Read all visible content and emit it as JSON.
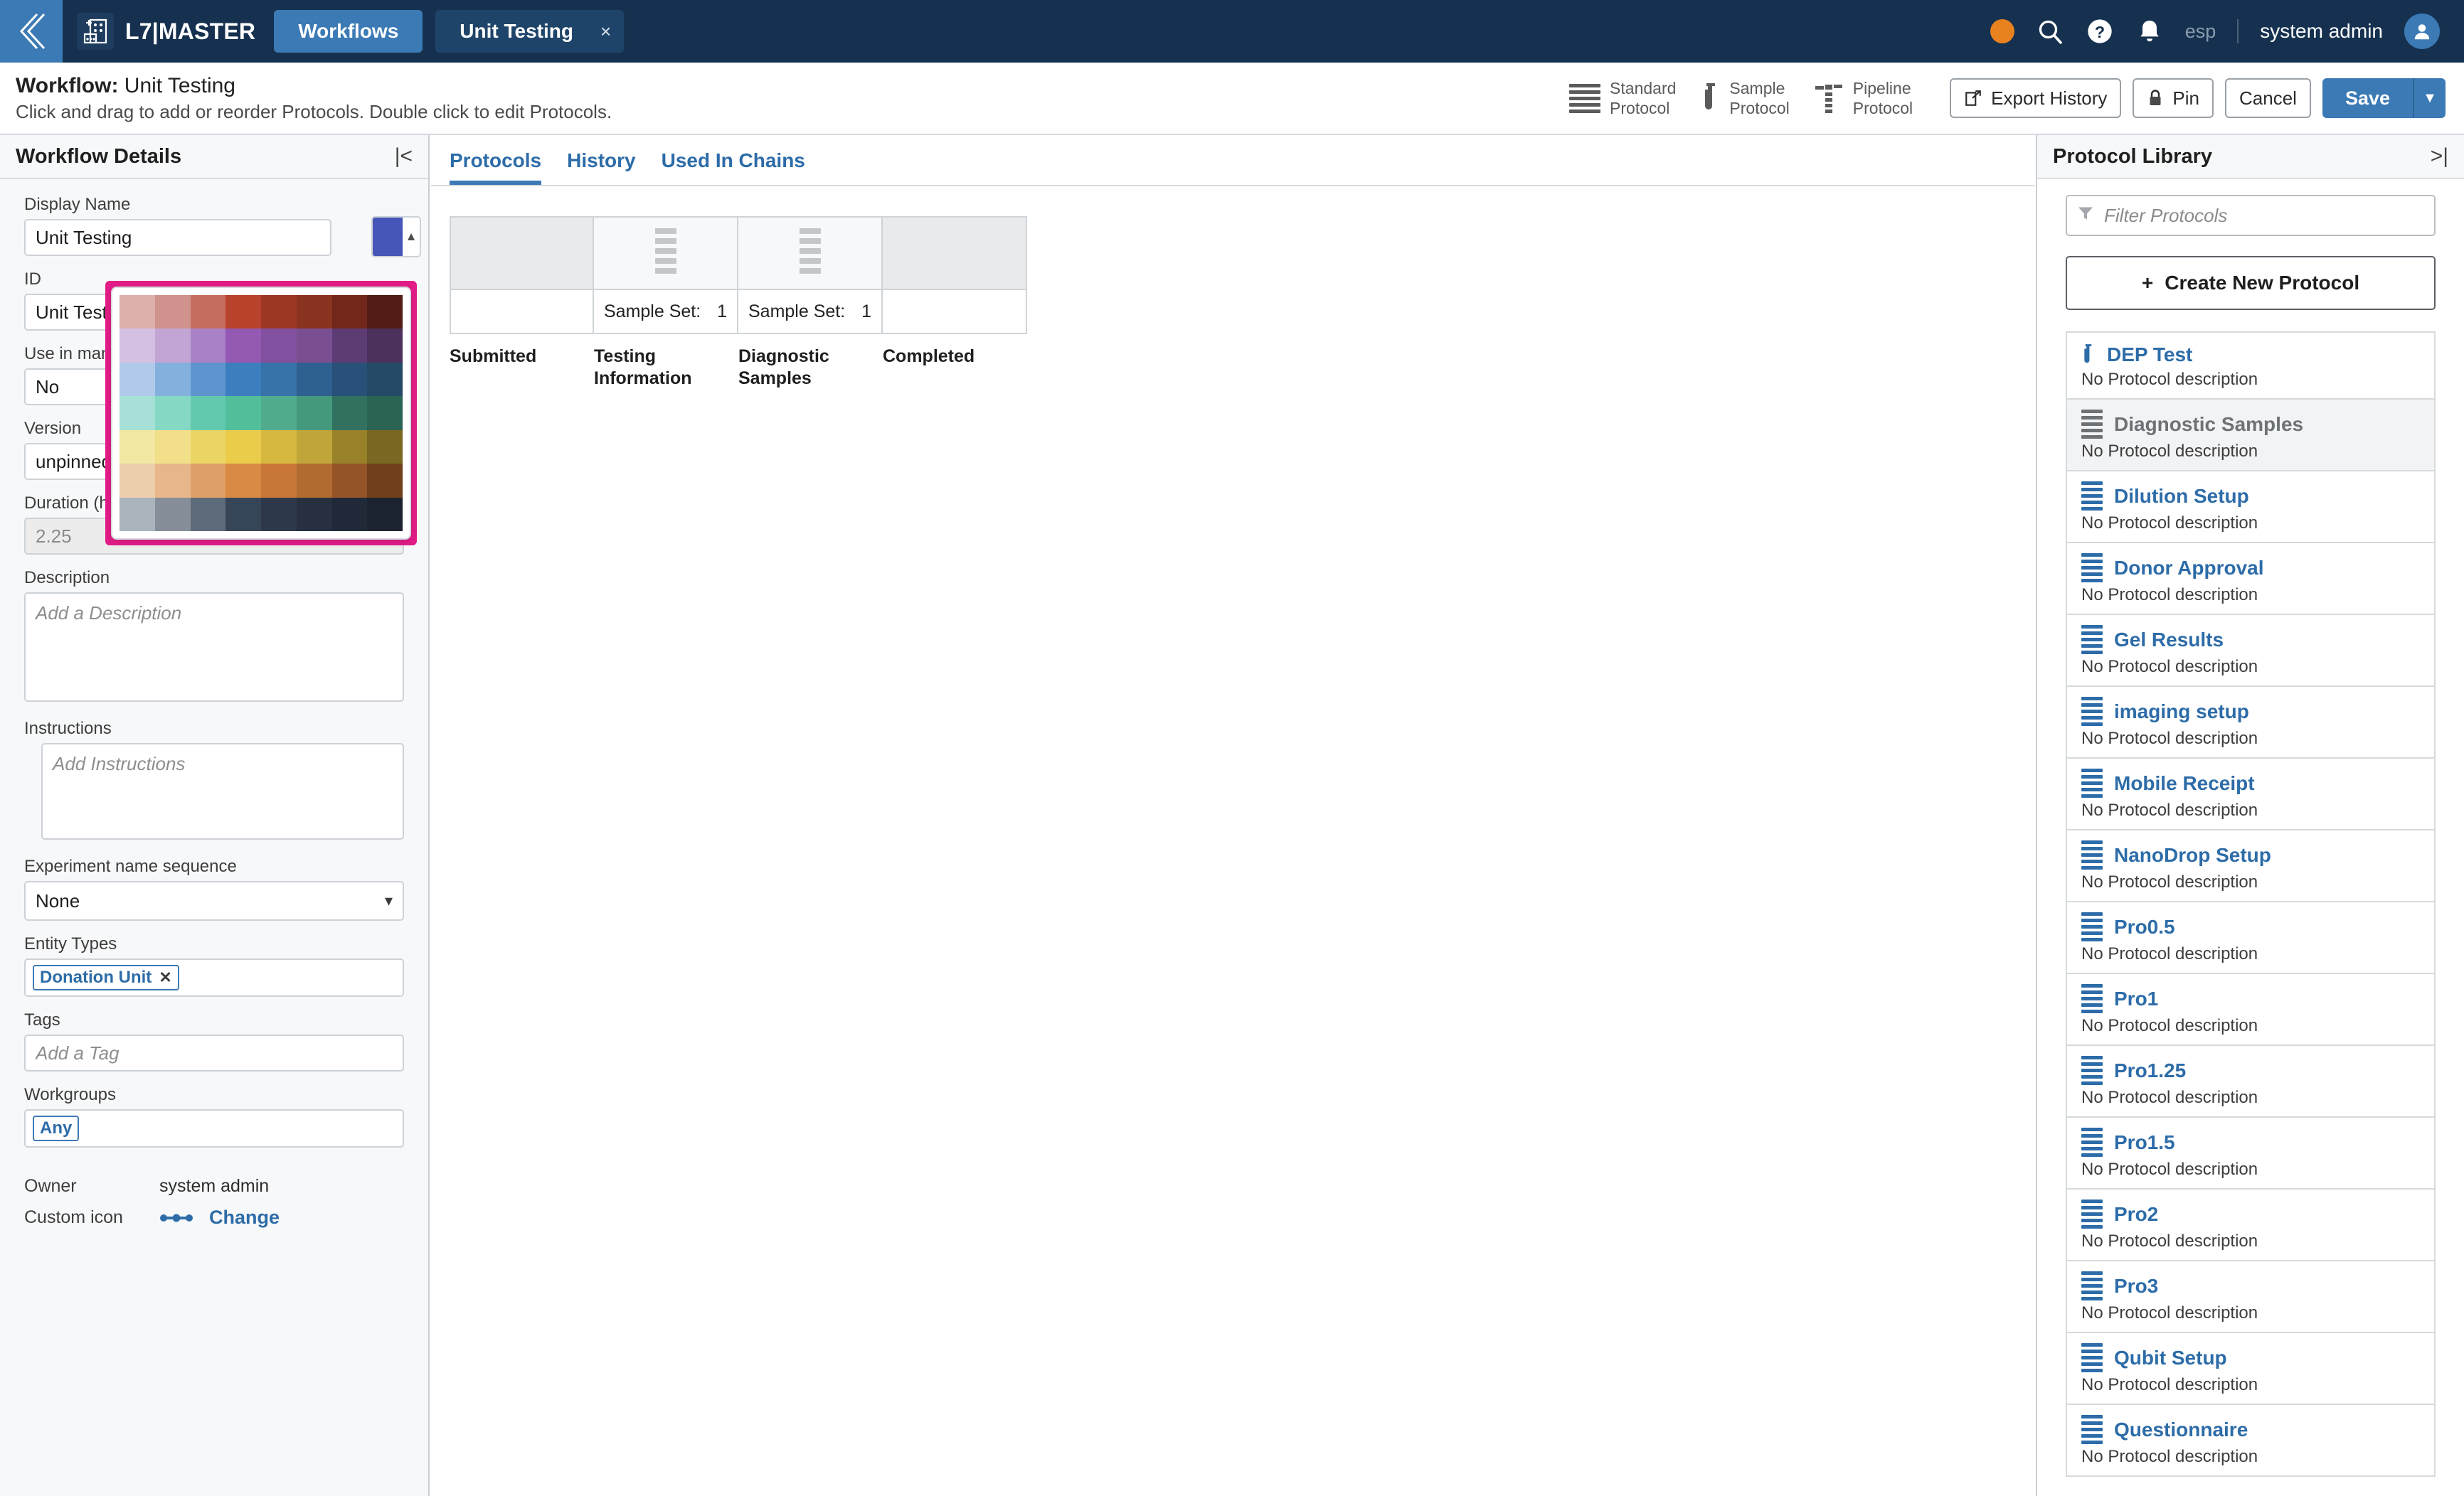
{
  "topnav": {
    "back_icon": "chevron-left-icon",
    "logo_icon": "lab-plate-icon",
    "app_title": "L7|MASTER",
    "tab_workflows": "Workflows",
    "tab_document": "Unit Testing",
    "tab_close": "×",
    "status_dot_color": "#e8821e",
    "search_icon": "search-icon",
    "help_icon": "help-circle-icon",
    "bell_icon": "bell-icon",
    "language": "esp",
    "user_name": "system admin",
    "avatar_icon": "user-avatar-icon"
  },
  "subheader": {
    "title_prefix": "Workflow:",
    "title_value": "Unit Testing",
    "subtitle": "Click and drag to add or reorder Protocols. Double click to edit Protocols.",
    "protocol_types": [
      {
        "label": "Standard\nProtocol",
        "icon": "standard-protocol-icon"
      },
      {
        "label": "Sample\nProtocol",
        "icon": "sample-protocol-icon"
      },
      {
        "label": "Pipeline\nProtocol",
        "icon": "pipeline-protocol-icon"
      }
    ],
    "export_history_label": "Export History",
    "export_history_icon": "external-link-icon",
    "pin_label": "Pin",
    "pin_icon": "lock-icon",
    "cancel_label": "Cancel",
    "save_label": "Save",
    "save_dropdown_caret": "▼",
    "accent_color": "#3c7ab5"
  },
  "left_panel": {
    "title": "Workflow Details",
    "collapse_icon": "collapse-left-icon",
    "display_name": {
      "label": "Display Name",
      "value": "Unit Testing"
    },
    "color_swatch": {
      "color": "#4656b8",
      "caret": "▲"
    },
    "id": {
      "label": "ID",
      "value": "Unit Testing"
    },
    "use_in_manual": {
      "label": "Use in man",
      "value": "No"
    },
    "version": {
      "label": "Version",
      "value": "unpinned"
    },
    "duration": {
      "label": "Duration (h",
      "value": "2.25"
    },
    "description": {
      "label": "Description",
      "placeholder": "Add a Description",
      "value": ""
    },
    "instructions": {
      "label": "Instructions",
      "placeholder": "Add Instructions",
      "value": ""
    },
    "experiment_name_sequence": {
      "label": "Experiment name sequence",
      "value": "None",
      "options": [
        "None"
      ]
    },
    "entity_types": {
      "label": "Entity Types",
      "chips": [
        "Donation Unit"
      ],
      "chip_remove": "✕"
    },
    "tags": {
      "label": "Tags",
      "placeholder": "Add a Tag",
      "value": ""
    },
    "workgroups": {
      "label": "Workgroups",
      "chips": [
        "Any"
      ]
    },
    "owner": {
      "label": "Owner",
      "value": "system admin"
    },
    "custom_icon": {
      "label": "Custom icon",
      "change_label": "Change",
      "icon": "dumbbell-dots-icon"
    }
  },
  "color_picker": {
    "highlight_color": "#e31c87",
    "rows": [
      [
        "#ddb0ac",
        "#d0928c",
        "#c56d5e",
        "#b8432c",
        "#9c3724",
        "#8a3320",
        "#72271b",
        "#521d14"
      ],
      [
        "#d3c0e2",
        "#c2a5d5",
        "#a981c6",
        "#9459b2",
        "#81509f",
        "#7a4f92",
        "#5c3c73",
        "#4b315c"
      ],
      [
        "#b1caea",
        "#84b0de",
        "#5e95cf",
        "#3d7fbe",
        "#3772a8",
        "#2e6090",
        "#275179",
        "#244a68"
      ],
      [
        "#a6e0d6",
        "#85d8c4",
        "#63c9ae",
        "#53be9a",
        "#51ab8d",
        "#44997d",
        "#327160",
        "#2b6454"
      ],
      [
        "#f2e7a3",
        "#f1df8a",
        "#ebd564",
        "#eacb4a",
        "#d6b841",
        "#c0a63a",
        "#998129",
        "#7a6822"
      ],
      [
        "#eccdac",
        "#e7b68a",
        "#dfa067",
        "#d98a45",
        "#c97736",
        "#b16b30",
        "#945427",
        "#70401c"
      ],
      [
        "#a9b4bd",
        "#868f99",
        "#5d6b7a",
        "#374559",
        "#2d394b",
        "#26303f",
        "#202937",
        "#1b2330"
      ]
    ]
  },
  "center_panel": {
    "tabs": [
      {
        "label": "Protocols",
        "active": true
      },
      {
        "label": "History",
        "active": false
      },
      {
        "label": "Used In Chains",
        "active": false
      }
    ],
    "nodes": [
      {
        "label": "Submitted",
        "type": "terminal",
        "icon": null,
        "meta_key": null,
        "meta_value": null
      },
      {
        "label": "Testing Information",
        "type": "protocol",
        "icon": "standard-protocol-icon",
        "meta_key": "Sample Set:",
        "meta_value": "1"
      },
      {
        "label": "Diagnostic Samples",
        "type": "protocol",
        "icon": "standard-protocol-icon",
        "meta_key": "Sample Set:",
        "meta_value": "1"
      },
      {
        "label": "Completed",
        "type": "terminal",
        "icon": null,
        "meta_key": null,
        "meta_value": null
      }
    ]
  },
  "right_panel": {
    "title": "Protocol Library",
    "collapse_icon": "collapse-right-icon",
    "filter": {
      "placeholder": "Filter Protocols",
      "value": "",
      "icon": "funnel-icon"
    },
    "create_new_protocol": {
      "label": "Create New Protocol",
      "icon": "plus-icon"
    },
    "protocols": [
      {
        "name": "DEP Test",
        "desc": "No Protocol description",
        "icon": "sample-protocol-icon",
        "dimmed": false
      },
      {
        "name": "Diagnostic Samples",
        "desc": "No Protocol description",
        "icon": "standard-protocol-icon",
        "dimmed": true
      },
      {
        "name": "Dilution Setup",
        "desc": "No Protocol description",
        "icon": "standard-protocol-icon",
        "dimmed": false
      },
      {
        "name": "Donor Approval",
        "desc": "No Protocol description",
        "icon": "standard-protocol-icon",
        "dimmed": false
      },
      {
        "name": "Gel Results",
        "desc": "No Protocol description",
        "icon": "standard-protocol-icon",
        "dimmed": false
      },
      {
        "name": "imaging setup",
        "desc": "No Protocol description",
        "icon": "standard-protocol-icon",
        "dimmed": false
      },
      {
        "name": "Mobile Receipt",
        "desc": "No Protocol description",
        "icon": "standard-protocol-icon",
        "dimmed": false
      },
      {
        "name": "NanoDrop Setup",
        "desc": "No Protocol description",
        "icon": "standard-protocol-icon",
        "dimmed": false
      },
      {
        "name": "Pro0.5",
        "desc": "No Protocol description",
        "icon": "standard-protocol-icon",
        "dimmed": false
      },
      {
        "name": "Pro1",
        "desc": "No Protocol description",
        "icon": "standard-protocol-icon",
        "dimmed": false
      },
      {
        "name": "Pro1.25",
        "desc": "No Protocol description",
        "icon": "standard-protocol-icon",
        "dimmed": false
      },
      {
        "name": "Pro1.5",
        "desc": "No Protocol description",
        "icon": "standard-protocol-icon",
        "dimmed": false
      },
      {
        "name": "Pro2",
        "desc": "No Protocol description",
        "icon": "standard-protocol-icon",
        "dimmed": false
      },
      {
        "name": "Pro3",
        "desc": "No Protocol description",
        "icon": "standard-protocol-icon",
        "dimmed": false
      },
      {
        "name": "Qubit Setup",
        "desc": "No Protocol description",
        "icon": "standard-protocol-icon",
        "dimmed": false
      },
      {
        "name": "Questionnaire",
        "desc": "No Protocol description",
        "icon": "standard-protocol-icon",
        "dimmed": false
      }
    ]
  }
}
